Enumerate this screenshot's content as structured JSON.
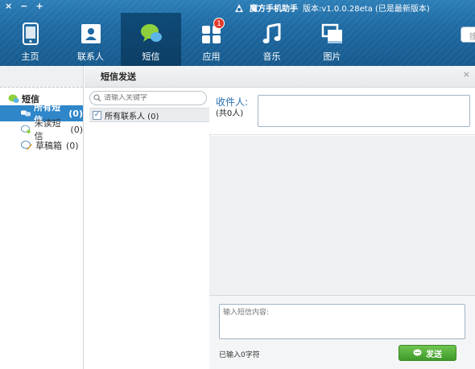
{
  "window": {
    "controls": [
      "×",
      "−",
      "+"
    ],
    "app_name": "魔方手机助手",
    "version_text": "版本:v1.0.0.28eta (已是最新版本)",
    "search_stub": "搜"
  },
  "nav": {
    "items": [
      {
        "label": "主页",
        "icon": "phone-icon"
      },
      {
        "label": "联系人",
        "icon": "contacts-icon"
      },
      {
        "label": "短信",
        "icon": "sms-icon"
      },
      {
        "label": "应用",
        "icon": "apps-icon",
        "badge": "1"
      },
      {
        "label": "音乐",
        "icon": "music-icon"
      },
      {
        "label": "图片",
        "icon": "pictures-icon"
      }
    ],
    "active_index": 2
  },
  "sidebar": {
    "root_label": "短信",
    "items": [
      {
        "label": "所有短信",
        "count": "(0)",
        "icon": "chat-bubbles-icon"
      },
      {
        "label": "未读短信",
        "count": "(0)",
        "icon": "unread-icon"
      },
      {
        "label": "草稿箱",
        "count": "(0)",
        "icon": "draft-icon"
      }
    ]
  },
  "panel": {
    "title": "短信发送",
    "close": "×",
    "search_placeholder": "请输入关键字",
    "all_contacts": "所有联系人 (0)",
    "recipient_label": "收件人:",
    "recipient_count": "(共0人)",
    "message_placeholder": "输入短信内容:",
    "char_count": "已输入0字符",
    "send_label": "发送"
  },
  "colors": {
    "topbar": "#1e6aa3",
    "nav_active": "#0d3f66",
    "selected": "#2f86c9",
    "send_button": "#3e9a2a",
    "badge": "#e23b2a"
  }
}
